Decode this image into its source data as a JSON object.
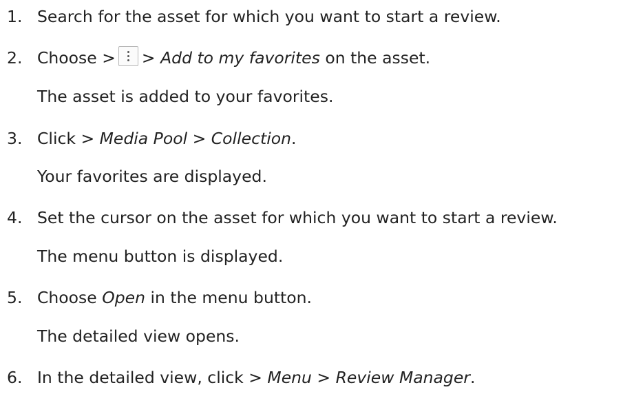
{
  "steps": [
    {
      "number": "1.",
      "text": "Search for the asset for which you want to start a review."
    },
    {
      "number": "2.",
      "prefix": "Choose >",
      "icon": "more-vertical-icon",
      "path": "> Add to my favorites",
      "suffix": " on the asset.",
      "result": "The asset is added to your favorites."
    },
    {
      "number": "3.",
      "prefix": "Click ",
      "path": "> Media Pool > Collection",
      "suffix": ".",
      "result": "Your favorites are displayed."
    },
    {
      "number": "4.",
      "text": "Set the cursor on the asset for which you want to start a review.",
      "result": "The menu button is displayed."
    },
    {
      "number": "5.",
      "prefix": "Choose ",
      "path": "Open",
      "suffix": " in the menu button.",
      "result": "The detailed view opens."
    },
    {
      "number": "6.",
      "prefix": "In the detailed view, click ",
      "path": "> Menu > Review Manager",
      "suffix": "."
    }
  ]
}
